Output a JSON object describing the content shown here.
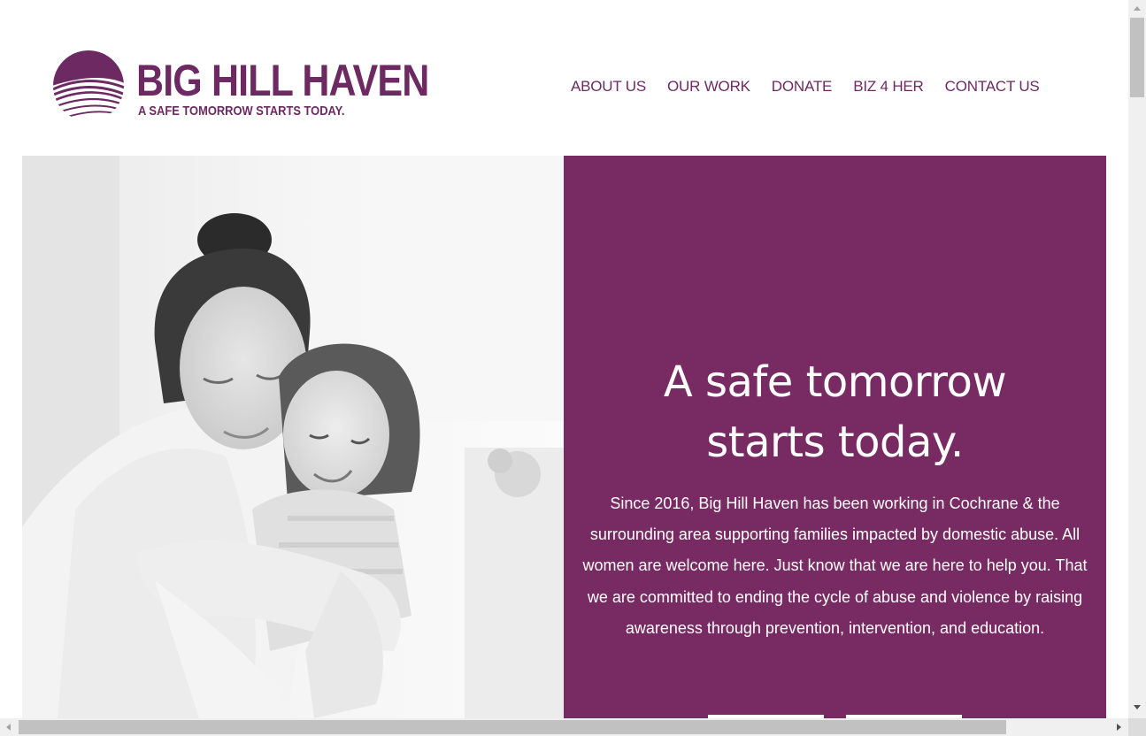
{
  "brand": {
    "name": "BIG HILL HAVEN",
    "tagline": "A SAFE TOMORROW STARTS TODAY.",
    "color": "#6d2a62"
  },
  "nav": {
    "items": [
      {
        "label": "ABOUT US"
      },
      {
        "label": "OUR WORK"
      },
      {
        "label": "DONATE"
      },
      {
        "label": "BIZ 4 HER"
      },
      {
        "label": "CONTACT US"
      }
    ]
  },
  "hero": {
    "image": "photo-mother-hugging-child",
    "title_line1": "A safe tomorrow",
    "title_line2": "starts today.",
    "body": "Since 2016, Big Hill Haven has been working in Cochrane & the surrounding area supporting families impacted by domestic abuse. All women are welcome here. Just know that we are here to help you. That we are committed to ending the cycle of abuse and violence by raising awareness through prevention, intervention, and education.",
    "panel_color": "#772b62"
  }
}
